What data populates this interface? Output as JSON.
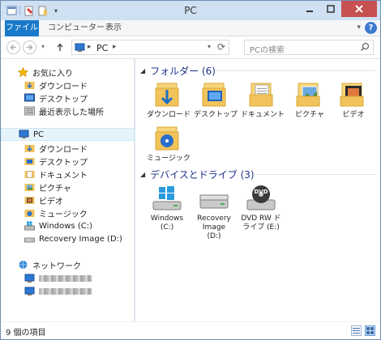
{
  "window": {
    "title": "PC"
  },
  "ribbon": {
    "tabs": [
      "ファイル",
      "コンピューター",
      "表示"
    ]
  },
  "address": {
    "crumb": "PC"
  },
  "search": {
    "placeholder": "PCの検索"
  },
  "nav": {
    "favorites_label": "お気に入り",
    "favorites": [
      "ダウンロード",
      "デスクトップ",
      "最近表示した場所"
    ],
    "pc_label": "PC",
    "pc_items": [
      "ダウンロード",
      "デスクトップ",
      "ドキュメント",
      "ピクチャ",
      "ビデオ",
      "ミュージック",
      "Windows  (C:)",
      "Recovery Image (D:)"
    ],
    "network_label": "ネットワーク"
  },
  "folders": {
    "header": "フォルダー (6)",
    "items": [
      "ダウンロード",
      "デスクトップ",
      "ドキュメント",
      "ピクチャ",
      "ビデオ",
      "ミュージック"
    ]
  },
  "drives": {
    "header": "デバイスとドライブ (3)",
    "items": [
      {
        "lines": [
          "Windows",
          "(C:)"
        ]
      },
      {
        "lines": [
          "Recovery",
          "Image",
          "(D:)"
        ]
      },
      {
        "lines": [
          "DVD RW ド",
          "ライブ (E:)"
        ],
        "badge": "DVD"
      }
    ]
  },
  "status": {
    "count": "9 個の項目"
  },
  "colors": {
    "file_tab": "#1979ca",
    "close": "#c75050",
    "section": "#1e3287",
    "folder": "#f2c35a"
  }
}
